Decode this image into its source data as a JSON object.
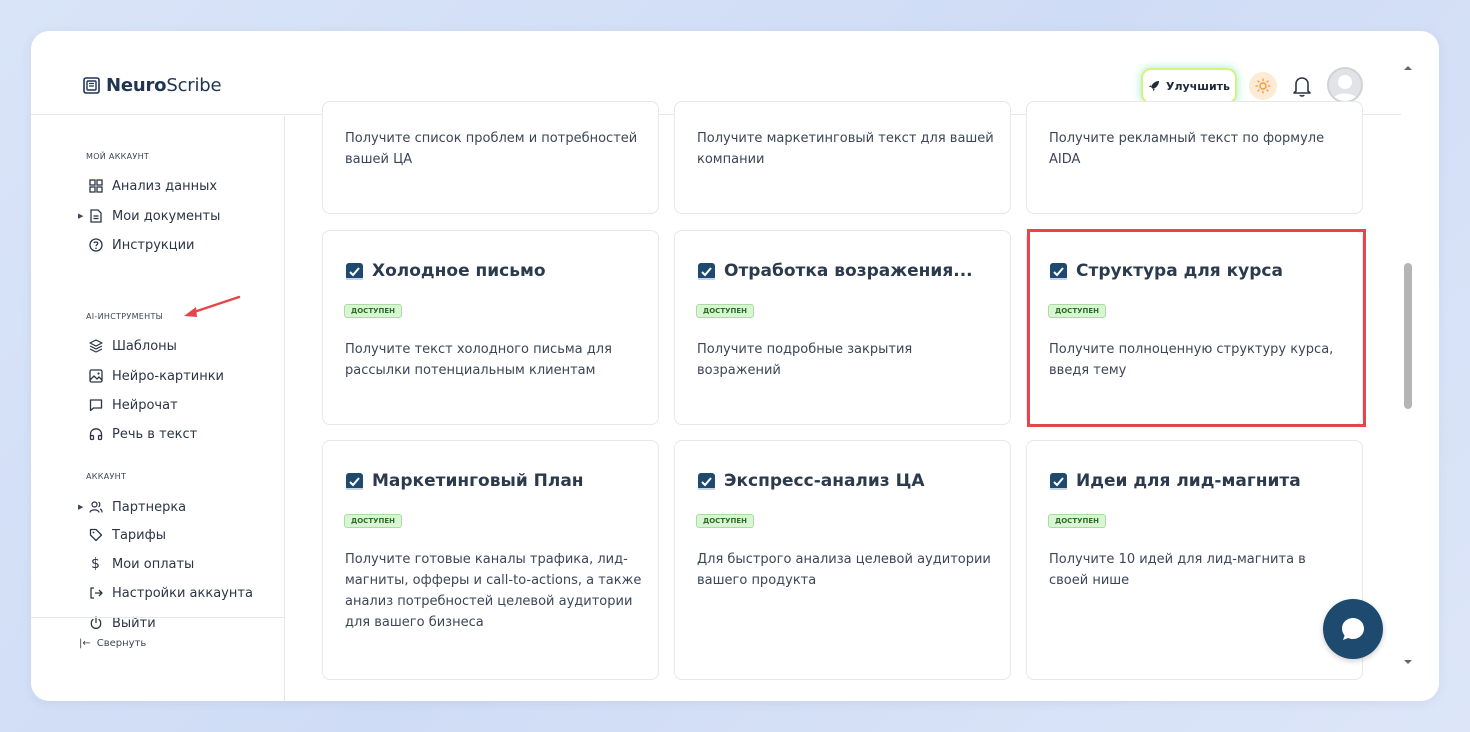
{
  "brand": {
    "bold": "Neuro",
    "regular": "Scribe"
  },
  "header": {
    "upgrade_label": "Улучшить"
  },
  "sidebar": {
    "sections": [
      {
        "title": "Мой аккаунт"
      },
      {
        "title": "AI-инструменты"
      },
      {
        "title": "Аккаунт"
      }
    ],
    "items": [
      {
        "label": "Анализ данных",
        "icon": "grid-icon"
      },
      {
        "label": "Мои документы",
        "icon": "document-icon"
      },
      {
        "label": "Инструкции",
        "icon": "help-circle-icon"
      },
      {
        "label": "Шаблоны",
        "icon": "layers-icon"
      },
      {
        "label": "Нейро-картинки",
        "icon": "image-icon"
      },
      {
        "label": "Нейрочат",
        "icon": "chat-icon"
      },
      {
        "label": "Речь в текст",
        "icon": "headphones-icon"
      },
      {
        "label": "Партнерка",
        "icon": "users-icon"
      },
      {
        "label": "Тарифы",
        "icon": "tag-icon"
      },
      {
        "label": "Мои оплаты",
        "icon": "dollar-icon"
      },
      {
        "label": "Настройки аккаунта",
        "icon": "settings-exit-icon"
      },
      {
        "label": "Выйти",
        "icon": "power-icon"
      }
    ],
    "collapse_label": "Свернуть"
  },
  "cards": [
    {
      "title": "",
      "badge": "",
      "desc": "Получите список проблем и потребностей вашей ЦА"
    },
    {
      "title": "",
      "badge": "",
      "desc": "Получите маркетинговый текст для вашей компании"
    },
    {
      "title": "",
      "badge": "",
      "desc": "Получите рекламный текст по формуле AIDA"
    },
    {
      "title": "Холодное письмо",
      "badge": "доступен",
      "desc": "Получите текст холодного письма для рассылки потенциальным клиентам"
    },
    {
      "title": "Отработка возражения...",
      "badge": "доступен",
      "desc": "Получите подробные закрытия возражений"
    },
    {
      "title": "Структура для курса",
      "badge": "доступен",
      "desc": "Получите полноценную структуру курса, введя тему"
    },
    {
      "title": "Маркетинговый План",
      "badge": "доступен",
      "desc": "Получите готовые каналы трафика, лид-магниты, офферы и call-to-actions, а также анализ потребностей целевой аудитории для вашего бизнеса"
    },
    {
      "title": "Экспресс-анализ ЦА",
      "badge": "доступен",
      "desc": "Для быстрого анализа целевой аудитории вашего продукта"
    },
    {
      "title": "Идеи для лид-магнита",
      "badge": "доступен",
      "desc": "Получите 10 идей для лид-магнита в своей нише"
    }
  ],
  "colors": {
    "accent": "#1d4a6e",
    "highlight": "#e4474a",
    "badge_bg": "#d9f5d4"
  }
}
